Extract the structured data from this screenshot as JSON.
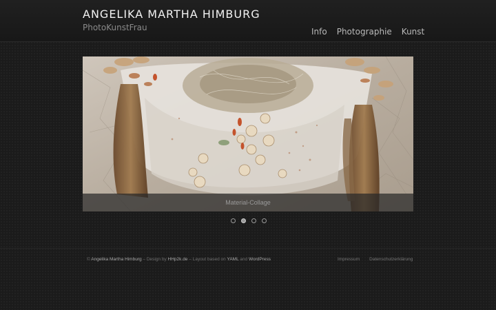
{
  "header": {
    "site_title": "ANGELIKA MARTHA HIMBURG",
    "site_subtitle": "PhotoKunstFrau"
  },
  "nav": {
    "items": [
      {
        "label": "Info"
      },
      {
        "label": "Photographie"
      },
      {
        "label": "Kunst"
      }
    ]
  },
  "slider": {
    "caption": "Material-Collage",
    "slide_count": 4,
    "active_index": 2
  },
  "footer": {
    "copyright_prefix": "©",
    "author_link": "Angelika Martha Himburg",
    "design_text": "– Design by",
    "design_link": "HHp2k.de",
    "layout_text": "– Layout based on",
    "yaml_link": "YAML",
    "and_text": "and",
    "wordpress_link": "WordPress",
    "impressum": "Impressum",
    "datenschutz": "Datenschutzerklärung"
  },
  "colors": {
    "background": "#1b1b1b",
    "title": "#f2f2f2",
    "nav_text": "#b9b9b9"
  }
}
